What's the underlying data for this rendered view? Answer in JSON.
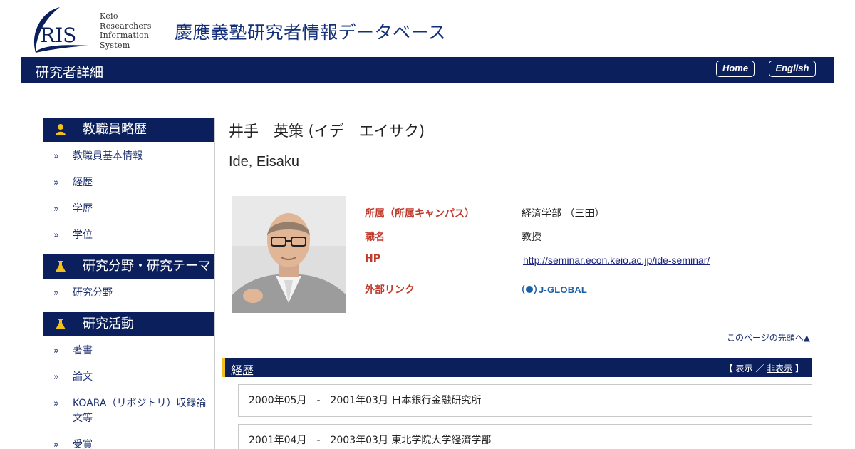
{
  "header": {
    "logo_letters": "RIS",
    "logo_lines": [
      "Keio",
      "Researchers",
      "Information",
      "System"
    ],
    "site_title": "慶應義塾研究者情報データベース"
  },
  "navbar": {
    "title": "研究者詳細",
    "home_label": "Home",
    "english_label": "English"
  },
  "sidebar": {
    "sections": [
      {
        "title": "教職員略歴",
        "icon": "person-icon",
        "items": [
          "教職員基本情報",
          "経歴",
          "学歴",
          "学位"
        ]
      },
      {
        "title": "研究分野・研究テーマ",
        "icon": "flask-icon",
        "items": [
          "研究分野"
        ]
      },
      {
        "title": "研究活動",
        "icon": "flask-icon",
        "items": [
          "著書",
          "論文",
          "KOARA（リポジトリ）収録論文等",
          "受賞"
        ]
      }
    ]
  },
  "profile": {
    "name_ja": "井手　英策 (イデ　エイサク)",
    "name_en": "Ide, Eisaku",
    "affiliation_label": "所属（所属キャンパス）",
    "affiliation_value": "経済学部 （三田）",
    "position_label": "職名",
    "position_value": "教授",
    "hp_label": "HP",
    "hp_value": "http://seminar.econ.keio.ac.jp/ide-seminar/",
    "external_label": "外部リンク",
    "external_value": "J-GLOBAL"
  },
  "page_top_link": "このページの先頭へ▲",
  "career_section": {
    "title": "経歴",
    "toggle_open": "【 表示 ／ ",
    "toggle_hide": "非表示",
    "toggle_close": " 】",
    "entries": [
      {
        "period": "2000年05月　-　2001年03月",
        "org": "日本銀行金融研究所"
      },
      {
        "period": "2001年04月　-　2003年03月",
        "org": "東北学院大学経済学部"
      }
    ]
  },
  "colors": {
    "navy": "#0a1f5c",
    "accent_yellow": "#f2c01c",
    "label_red": "#c0392b",
    "link_blue": "#1a237e"
  }
}
